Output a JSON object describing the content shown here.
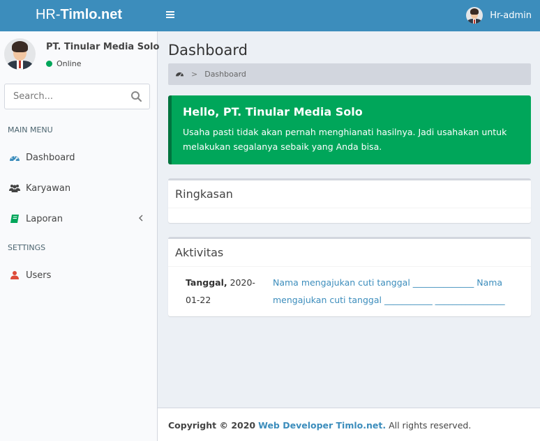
{
  "header": {
    "logo_light": "HR-",
    "logo_bold": "Timlo.net",
    "user_name": "Hr-admin",
    "color": "#3c8dbc"
  },
  "sidebar": {
    "user_name": "PT. Tinular Media Solo",
    "user_status": "Online",
    "search_placeholder": "Search...",
    "main_menu_header": "MAIN MENU",
    "settings_header": "SETTINGS",
    "items": [
      {
        "label": "Dashboard",
        "icon": "dashboard-icon"
      },
      {
        "label": "Karyawan",
        "icon": "users-icon"
      },
      {
        "label": "Laporan",
        "icon": "book-icon"
      },
      {
        "label": "Users",
        "icon": "user-icon"
      }
    ]
  },
  "main": {
    "title": "Dashboard",
    "breadcrumb": {
      "separator": ">",
      "current": "Dashboard"
    },
    "callout": {
      "title": "Hello, PT. Tinular Media Solo",
      "text": "Usaha pasti tidak akan pernah menghianati hasilnya. Jadi usahakan untuk melakukan segalanya sebaik yang Anda bisa.",
      "color": "#00a65a"
    },
    "summary_box": {
      "title": "Ringkasan"
    },
    "activity_box": {
      "title": "Aktivitas",
      "rows": [
        {
          "date_label": "Tanggal,",
          "date_value": "2020-01-22",
          "text": "Nama mengajukan cuti tanggal ______________ Nama mengajukan cuti tanggal ___________ ________________"
        }
      ]
    }
  },
  "footer": {
    "copyright": "Copyright © 2020",
    "link": "Web Developer Timlo.net.",
    "suffix": "All rights reserved."
  }
}
